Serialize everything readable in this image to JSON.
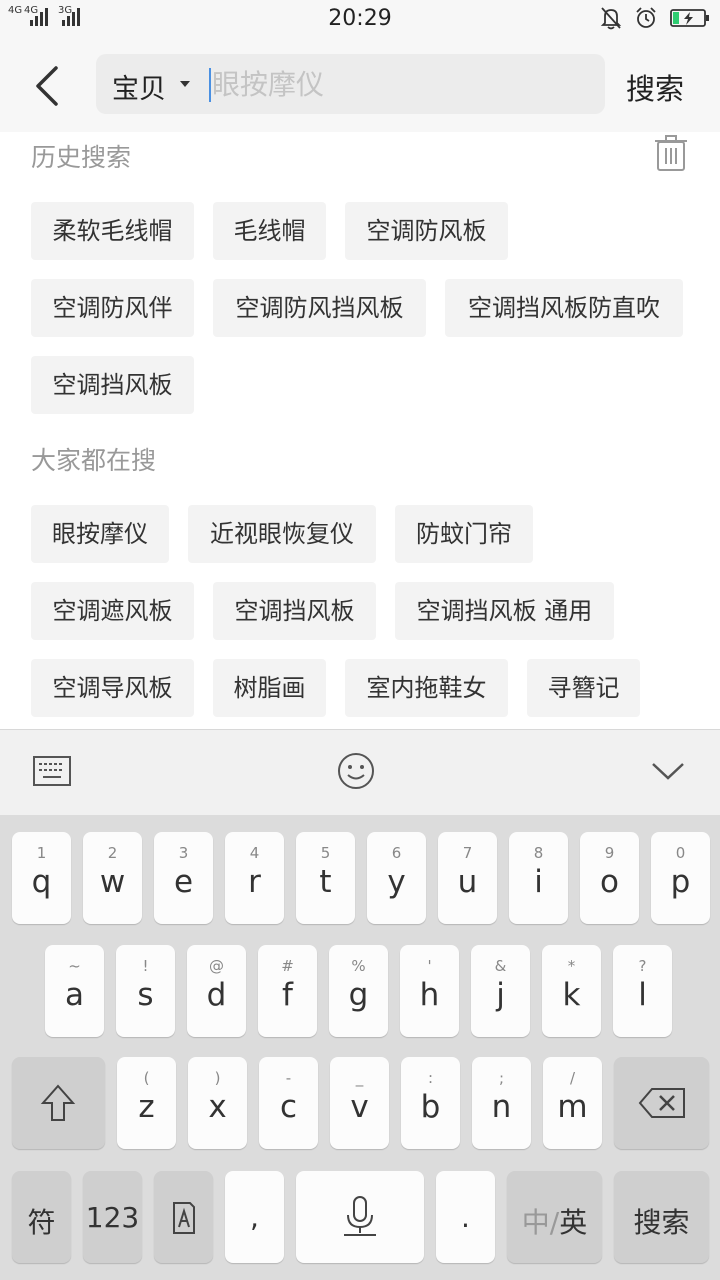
{
  "status_bar": {
    "network_1": "4G",
    "network_2": "4G",
    "network_3": "3G",
    "time": "20:29",
    "icons": [
      "bell-off-icon",
      "alarm-icon",
      "battery-charging-icon"
    ]
  },
  "header": {
    "scope_label": "宝贝",
    "search_placeholder": "眼按摩仪",
    "search_button": "搜索"
  },
  "history": {
    "title": "历史搜索",
    "tags": [
      "柔软毛线帽",
      "毛线帽",
      "空调防风板",
      "空调防风伴",
      "空调防风挡风板",
      "空调挡风板防直吹",
      "空调挡风板"
    ]
  },
  "popular": {
    "title": "大家都在搜",
    "tags": [
      "眼按摩仪",
      "近视眼恢复仪",
      "防蚊门帘",
      "空调遮风板",
      "空调挡风板",
      "空调挡风板 通用",
      "空调导风板",
      "树脂画",
      "室内拖鞋女",
      "寻簪记"
    ]
  },
  "keyboard": {
    "row1": [
      {
        "hint": "1",
        "key": "q"
      },
      {
        "hint": "2",
        "key": "w"
      },
      {
        "hint": "3",
        "key": "e"
      },
      {
        "hint": "4",
        "key": "r"
      },
      {
        "hint": "5",
        "key": "t"
      },
      {
        "hint": "6",
        "key": "y"
      },
      {
        "hint": "7",
        "key": "u"
      },
      {
        "hint": "8",
        "key": "i"
      },
      {
        "hint": "9",
        "key": "o"
      },
      {
        "hint": "0",
        "key": "p"
      }
    ],
    "row2": [
      {
        "hint": "~",
        "key": "a"
      },
      {
        "hint": "!",
        "key": "s"
      },
      {
        "hint": "@",
        "key": "d"
      },
      {
        "hint": "#",
        "key": "f"
      },
      {
        "hint": "%",
        "key": "g"
      },
      {
        "hint": "'",
        "key": "h"
      },
      {
        "hint": "&",
        "key": "j"
      },
      {
        "hint": "*",
        "key": "k"
      },
      {
        "hint": "?",
        "key": "l"
      }
    ],
    "row3": [
      {
        "hint": "(",
        "key": "z"
      },
      {
        "hint": ")",
        "key": "x"
      },
      {
        "hint": "-",
        "key": "c"
      },
      {
        "hint": "_",
        "key": "v"
      },
      {
        "hint": ":",
        "key": "b"
      },
      {
        "hint": ";",
        "key": "n"
      },
      {
        "hint": "/",
        "key": "m"
      }
    ],
    "symbols_key": "符",
    "numbers_key": "123",
    "comma_key": ",",
    "period_key": ".",
    "lang_key_dim": "中/",
    "lang_key_active": "英",
    "enter_key": "搜索"
  }
}
